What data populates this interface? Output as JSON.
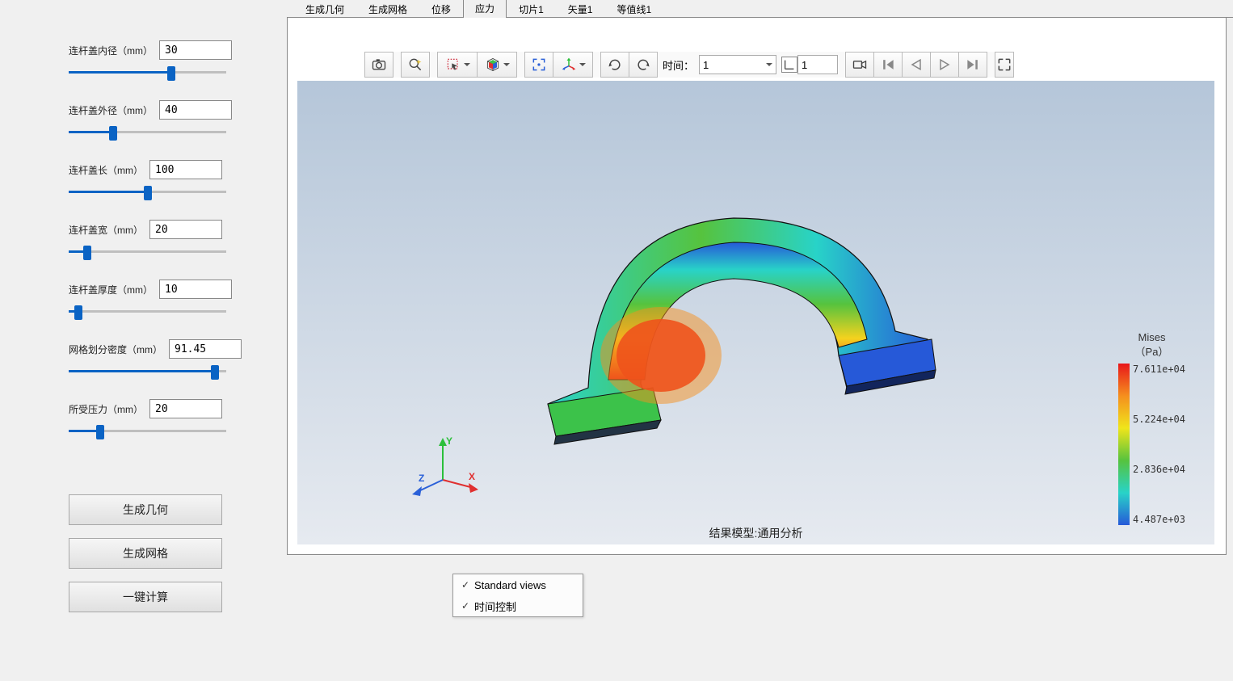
{
  "sidebar": {
    "params": [
      {
        "label": "连杆盖内径（mm）",
        "value": "30",
        "pct": 65
      },
      {
        "label": "连杆盖外径（mm）",
        "value": "40",
        "pct": 28
      },
      {
        "label": "连杆盖长（mm）",
        "value": "100",
        "pct": 50
      },
      {
        "label": "连杆盖宽（mm）",
        "value": "20",
        "pct": 12
      },
      {
        "label": "连杆盖厚度（mm）",
        "value": "10",
        "pct": 6
      },
      {
        "label": "网格划分密度（mm）",
        "value": "91.45",
        "pct": 93
      },
      {
        "label": "所受压力（mm）",
        "value": "20",
        "pct": 20
      }
    ],
    "buttons": {
      "geom": "生成几何",
      "mesh": "生成网格",
      "calc": "一键计算"
    }
  },
  "tabs": [
    {
      "label": "生成几何",
      "active": false
    },
    {
      "label": "生成网格",
      "active": false
    },
    {
      "label": "位移",
      "active": false
    },
    {
      "label": "应力",
      "active": true
    },
    {
      "label": "切片1",
      "active": false
    },
    {
      "label": "矢量1",
      "active": false
    },
    {
      "label": "等值线1",
      "active": false
    }
  ],
  "toolbar": {
    "time_label": "时间：",
    "time_select_value": "1",
    "time_input_value": "1"
  },
  "viewport": {
    "axes": {
      "x": "X",
      "y": "Y",
      "z": "Z"
    },
    "caption": "结果模型:通用分析"
  },
  "legend": {
    "title": "Mises",
    "unit": "（Pa）",
    "ticks": [
      "7.611e+04",
      "5.224e+04",
      "2.836e+04",
      "4.487e+03"
    ]
  },
  "chart_data": {
    "type": "heatmap",
    "title": "Mises Stress (Pa)",
    "colormap": "rainbow",
    "range_min": 4487,
    "range_max": 76110,
    "ticks": [
      4487,
      28360,
      52240,
      76110
    ],
    "unit": "Pa"
  },
  "menu": {
    "items": [
      {
        "label": "Standard views",
        "checked": true
      },
      {
        "label": "时间控制",
        "checked": true
      }
    ]
  }
}
